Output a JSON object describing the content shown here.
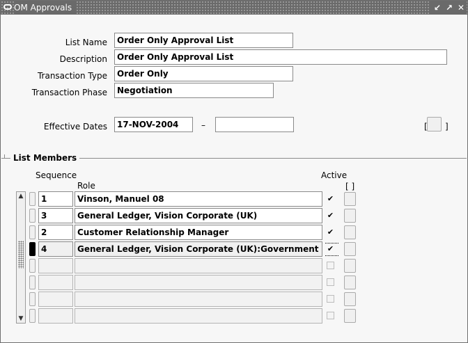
{
  "window": {
    "title": "OM Approvals"
  },
  "header": {
    "list_name_label": "List Name",
    "list_name": "Order Only Approval List",
    "description_label": "Description",
    "description": "Order Only Approval List",
    "transaction_type_label": "Transaction Type",
    "transaction_type": "Order Only",
    "transaction_phase_label": "Transaction Phase",
    "transaction_phase": "Negotiation",
    "effective_dates_label": "Effective Dates",
    "effective_from": "17-NOV-2004",
    "effective_to": "",
    "date_separator": "–",
    "dff_open": "[",
    "dff_close": "]"
  },
  "members": {
    "section_title": "List Members",
    "col_sequence": "Sequence",
    "col_role": "Role",
    "col_active": "Active",
    "col_dff": "[ ]",
    "rows": [
      {
        "sequence": "1",
        "role": "Vinson, Manuel 08",
        "active": "✔"
      },
      {
        "sequence": "3",
        "role": "General Ledger, Vision Corporate (UK)",
        "active": "✔"
      },
      {
        "sequence": "2",
        "role": "Customer Relationship Manager",
        "active": "✔"
      },
      {
        "sequence": "4",
        "role": "General Ledger, Vision Corporate (UK):Government",
        "active": "✔"
      },
      {
        "sequence": "",
        "role": "",
        "active": ""
      },
      {
        "sequence": "",
        "role": "",
        "active": ""
      },
      {
        "sequence": "",
        "role": "",
        "active": ""
      },
      {
        "sequence": "",
        "role": "",
        "active": ""
      }
    ]
  },
  "icons": {
    "title": "oracle-oval-icon",
    "titlebar_buttons": [
      "minimize-icon",
      "maximize-icon",
      "close-icon"
    ],
    "scroll": [
      "scroll-up-icon",
      "scroll-down-icon"
    ]
  }
}
